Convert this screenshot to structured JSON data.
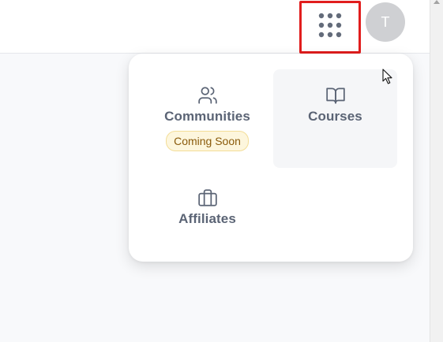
{
  "header": {
    "avatar_initial": "T",
    "apps_icon": "grid-dots-icon"
  },
  "menu": {
    "items": [
      {
        "label": "Communities",
        "icon": "users-icon",
        "badge": "Coming Soon"
      },
      {
        "label": "Courses",
        "icon": "book-open-icon",
        "badge": ""
      },
      {
        "label": "Affiliates",
        "icon": "briefcase-icon",
        "badge": ""
      }
    ]
  },
  "colors": {
    "highlight": "#e11d1d",
    "label": "#5b6475",
    "badge_text": "#8a5a0b",
    "badge_bg": "#fdf6dd"
  }
}
